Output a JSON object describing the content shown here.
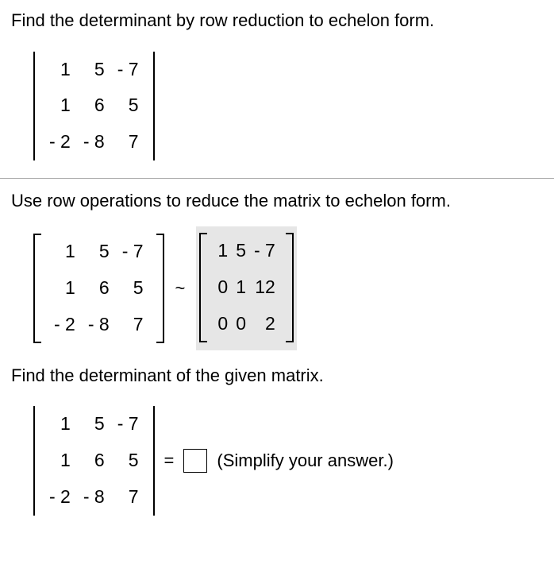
{
  "q_title": "Find the determinant by row reduction to echelon form.",
  "matrixA": {
    "r0": {
      "c0": "1",
      "c1": "5",
      "c2": "- 7"
    },
    "r1": {
      "c0": "1",
      "c1": "6",
      "c2": "5"
    },
    "r2": {
      "c0": "- 2",
      "c1": "- 8",
      "c2": "7"
    }
  },
  "step1_text": "Use row operations to reduce the matrix to echelon form.",
  "echelon": {
    "r0": {
      "c0": "1",
      "c1": "5",
      "c2": "- 7"
    },
    "r1": {
      "c0": "0",
      "c1": "1",
      "c2": "12"
    },
    "r2": {
      "c0": "0",
      "c1": "0",
      "c2": "2"
    }
  },
  "tilde": "~",
  "step2_text": "Find the determinant of the given matrix.",
  "equals": "=",
  "simplify_hint": "(Simplify your answer.)",
  "chart_data": {
    "type": "table",
    "matrices": {
      "original": [
        [
          1,
          5,
          -7
        ],
        [
          1,
          6,
          5
        ],
        [
          -2,
          -8,
          7
        ]
      ],
      "echelon": [
        [
          1,
          5,
          -7
        ],
        [
          0,
          1,
          12
        ],
        [
          0,
          0,
          2
        ]
      ]
    },
    "answer_box": null
  }
}
